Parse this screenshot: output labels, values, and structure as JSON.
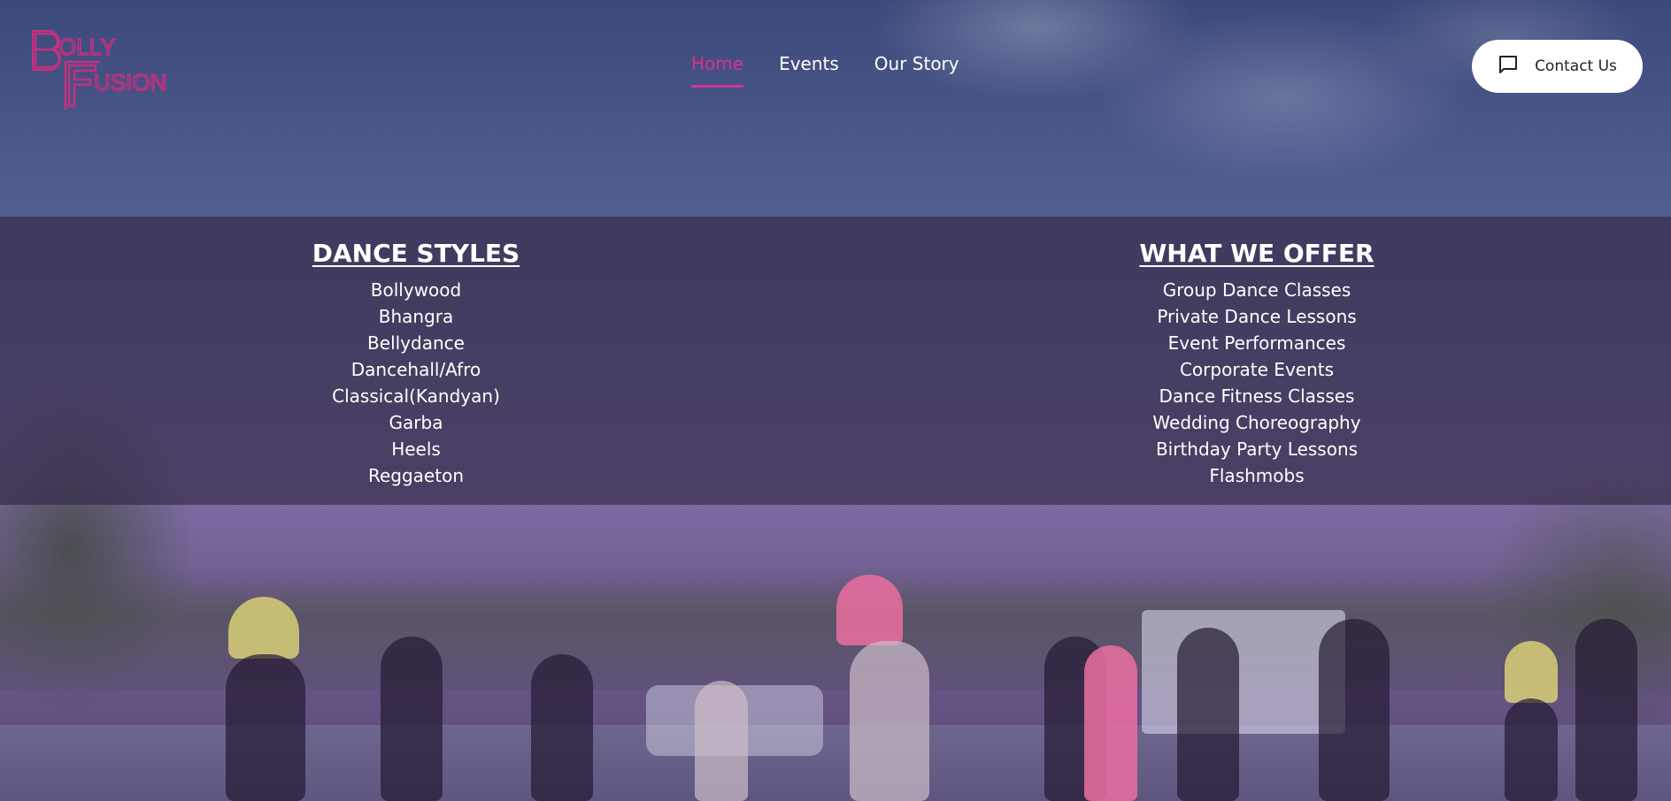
{
  "brand": {
    "logo_alt": "Bolly Fusion",
    "accent_color": "#d6338e"
  },
  "nav": {
    "items": [
      {
        "label": "Home",
        "active": true
      },
      {
        "label": "Events",
        "active": false
      },
      {
        "label": "Our Story",
        "active": false
      }
    ]
  },
  "contact": {
    "label": "Contact Us",
    "icon": "chat-icon"
  },
  "dance_styles": {
    "title": "DANCE STYLES",
    "items": [
      "Bollywood",
      "Bhangra",
      "Bellydance",
      "Dancehall/Afro",
      "Classical(Kandyan)",
      "Garba",
      "Heels",
      "Reggaeton"
    ]
  },
  "what_we_offer": {
    "title": "WHAT WE OFFER",
    "items": [
      "Group Dance Classes",
      "Private Dance Lessons",
      "Event Performances",
      "Corporate Events",
      "Dance Fitness Classes",
      "Wedding Choreography",
      "Birthday Party Lessons",
      "Flashmobs"
    ]
  }
}
